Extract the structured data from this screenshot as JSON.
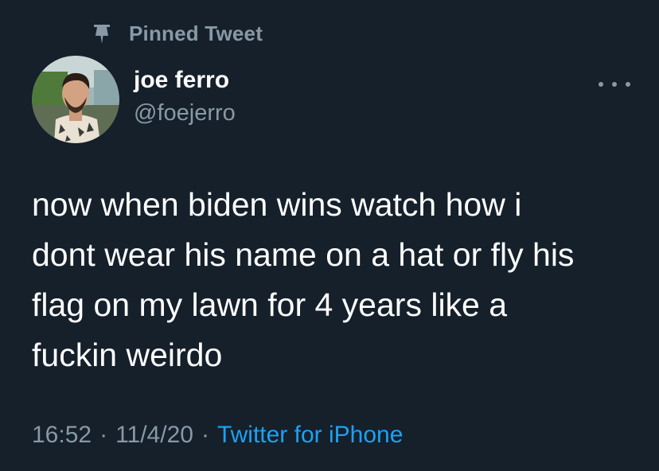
{
  "pinned": {
    "icon": "pin-icon",
    "label": "Pinned Tweet"
  },
  "author": {
    "display_name": "joe ferro",
    "handle": "@foejerro",
    "avatar_icon": "avatar"
  },
  "more_icon": "more-options-icon",
  "tweet": {
    "lines": [
      "now when biden wins watch how i",
      "dont wear his name on a hat or fly his",
      "flag on my lawn for 4 years like a",
      "fuckin weirdo"
    ]
  },
  "meta": {
    "time": "16:52",
    "separator": "·",
    "date": "11/4/20",
    "source": "Twitter for iPhone"
  },
  "colors": {
    "background": "#15202b",
    "primary_text": "#ffffff",
    "secondary_text": "#8899a6",
    "link": "#1da1f2"
  }
}
